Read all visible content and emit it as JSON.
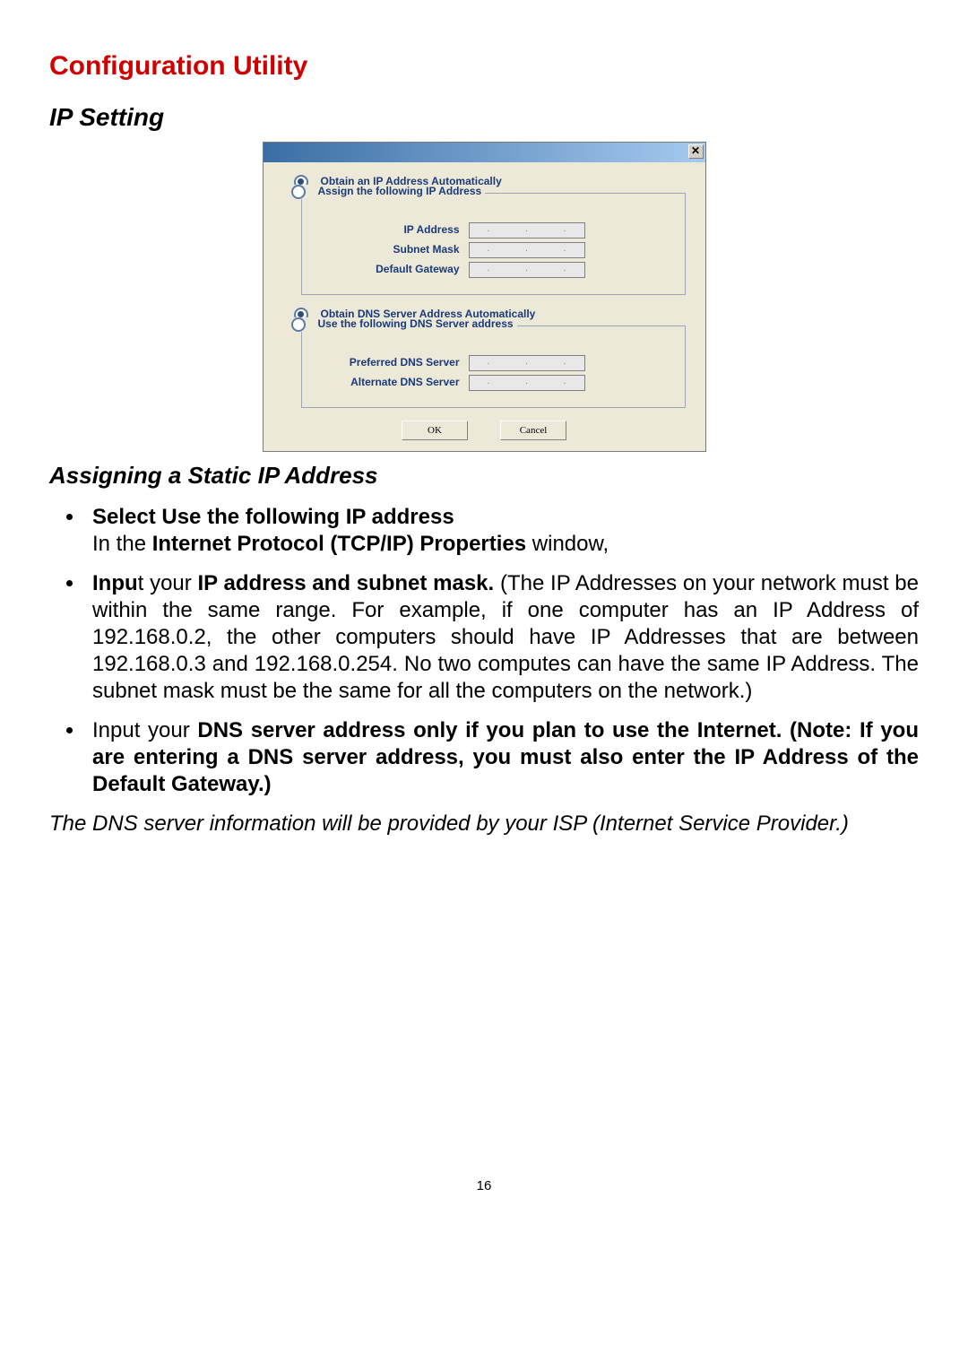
{
  "heading1": "Configuration Utility",
  "heading2": "IP Setting",
  "heading3": "Assigning a Static IP Address",
  "dialog": {
    "close": "✕",
    "ip_auto": "Obtain an IP Address Automatically",
    "ip_manual": "Assign the following IP Address",
    "ip_address_label": "IP Address",
    "subnet_label": "Subnet Mask",
    "gateway_label": "Default Gateway",
    "dns_auto": "Obtain DNS Server Address Automatically",
    "dns_manual": "Use the following DNS Server address",
    "pref_dns_label": "Preferred DNS Server",
    "alt_dns_label": "Alternate DNS Server",
    "ok": "OK",
    "cancel": "Cancel",
    "dots": ". . ."
  },
  "bullets": {
    "b1_line1_bold": "Select Use the following IP address",
    "b1_line2_pre": "In the ",
    "b1_line2_bold": "Internet Protocol (TCP/IP) Properties",
    "b1_line2_post": " window,",
    "b2_bold1": "Inpu",
    "b2_plain1": "t your ",
    "b2_bold2": "IP address and subnet mask.",
    "b2_rest": " (The IP Addresses on your network must be within the same range. For example, if one computer has an IP Address of 192.168.0.2, the other computers should have IP Addresses that are between 192.168.0.3 and 192.168.0.254.  No two computes can have the same IP Address.  The subnet mask must be the same for all the computers on the network.)",
    "b3_plain1": "Input your ",
    "b3_bold1": "DNS server address only if you plan to use the Internet.  (Note:  If you are entering a DNS server address, you must also enter the IP Address of the Default Gateway.)"
  },
  "footer_italic": "The DNS server information will be provided by your ISP (Internet Service Provider.)",
  "page_number": "16"
}
